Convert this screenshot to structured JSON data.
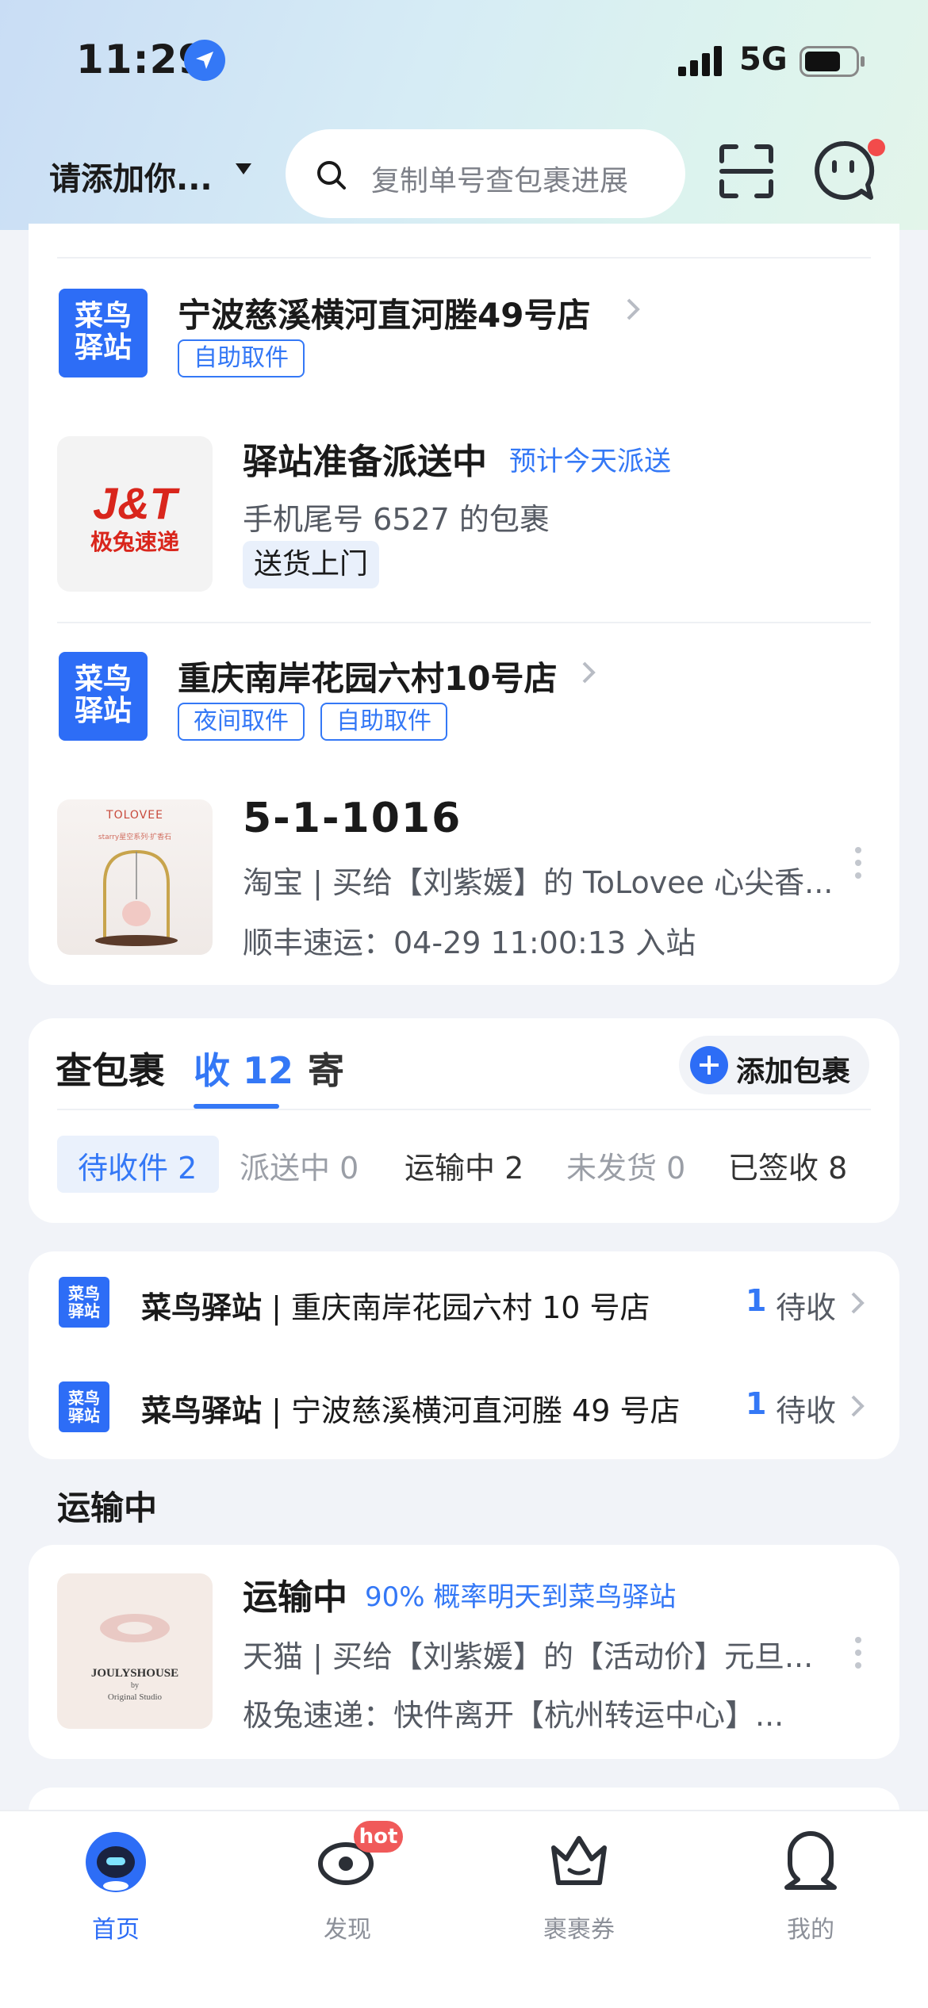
{
  "status_bar": {
    "time": "11:29",
    "network": "5G"
  },
  "header": {
    "address_label": "请添加你...",
    "search_placeholder": "复制单号查包裹进展"
  },
  "pickup_card": {
    "groups": [
      {
        "station_logo": [
          "菜鸟",
          "驿站"
        ],
        "station_name": "宁波慈溪横河直河塍49号店",
        "tags": [
          "自助取件"
        ],
        "package": {
          "title": "驿站准备派送中",
          "eta": "预计今天派送",
          "desc": "手机尾号 6527 的包裹",
          "service_tag": "送货上门",
          "carrier_logo_text": [
            "J&T",
            "极兔速递"
          ]
        }
      },
      {
        "station_logo": [
          "菜鸟",
          "驿站"
        ],
        "station_name": "重庆南岸花园六村10号店",
        "tags": [
          "夜间取件",
          "自助取件"
        ],
        "package": {
          "title": "5-1-1016",
          "desc": "淘宝 | 买给【刘紫媛】的 ToLovee 心尖香...",
          "status_line": "顺丰速运：04-29 11:00:13 入站",
          "thumb_texts": [
            "TOLOVEE",
            "starry星空系列·扩香石"
          ]
        }
      }
    ]
  },
  "package_tabs": {
    "title": "查包裹",
    "receive_label": "收",
    "receive_count": "12",
    "send_label": "寄",
    "add_button": "添加包裹",
    "sub_tabs": [
      {
        "label": "待收件",
        "count": "2"
      },
      {
        "label": "派送中",
        "count": "0"
      },
      {
        "label": "运输中",
        "count": "2"
      },
      {
        "label": "未发货",
        "count": "0"
      },
      {
        "label": "已签收",
        "count": "8"
      }
    ]
  },
  "stations_summary": [
    {
      "brand": "菜鸟驿站",
      "name": "重庆南岸花园六村 10 号店",
      "count": "1",
      "status": "待收"
    },
    {
      "brand": "菜鸟驿站",
      "name": "宁波慈溪横河直河塍 49 号店",
      "count": "1",
      "status": "待收"
    }
  ],
  "in_transit": {
    "section_title": "运输中",
    "item": {
      "title": "运输中",
      "prediction": "90% 概率明天到菜鸟驿站",
      "desc": "天猫 | 买给【刘紫媛】的【活动价】元旦...",
      "status_line": "极兔速递：快件离开【杭州转运中心】...",
      "thumb_texts": [
        "JOULYSHOUSE",
        "by",
        "Original Studio"
      ]
    }
  },
  "bottom_nav": [
    {
      "label": "首页",
      "active": true
    },
    {
      "label": "发现",
      "badge": "hot"
    },
    {
      "label": "裹裹券"
    },
    {
      "label": "我的"
    }
  ],
  "colors": {
    "accent": "#3478f6",
    "brand_blue": "#2d6df6",
    "badge_red": "#f05a5a",
    "jt_red": "#d9261c"
  }
}
